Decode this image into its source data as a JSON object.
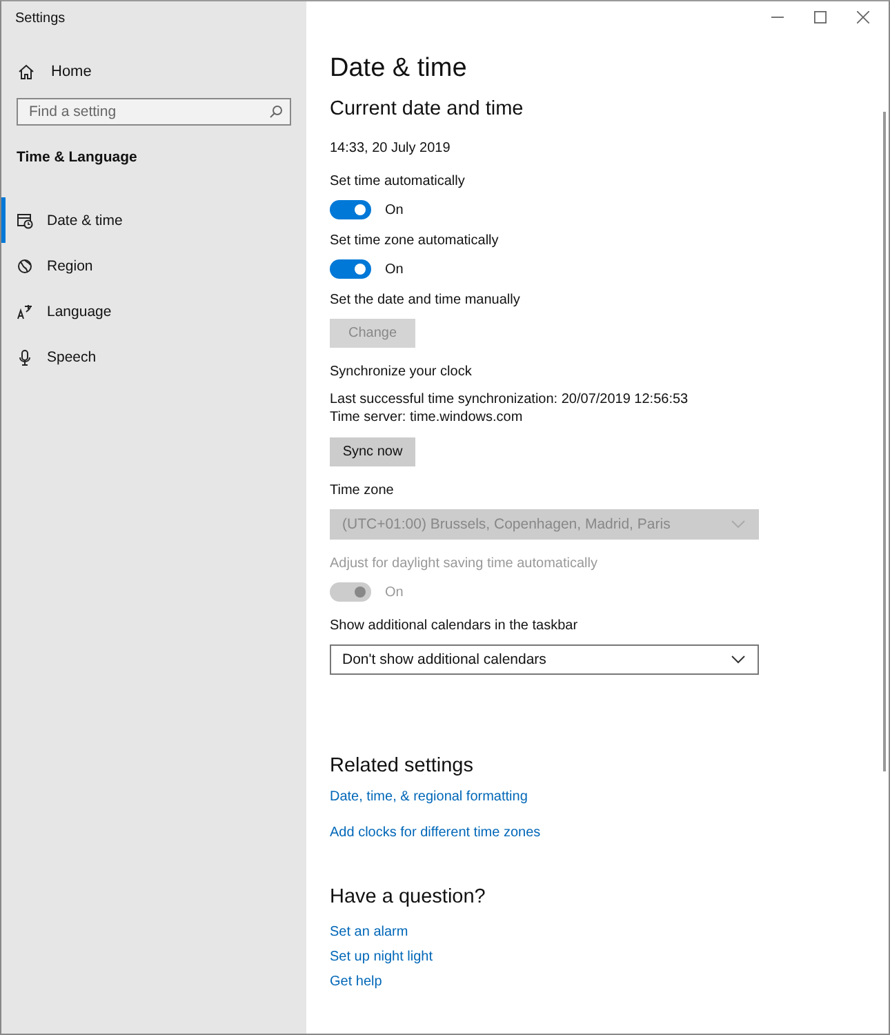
{
  "window": {
    "title": "Settings"
  },
  "sidebar": {
    "home": "Home",
    "search": {
      "placeholder": "Find a setting"
    },
    "section": "Time & Language",
    "items": [
      {
        "label": "Date & time",
        "kind": "calendar",
        "selected": true
      },
      {
        "label": "Region",
        "kind": "globe",
        "selected": false
      },
      {
        "label": "Language",
        "kind": "language",
        "selected": false
      },
      {
        "label": "Speech",
        "kind": "microphone",
        "selected": false
      }
    ]
  },
  "page": {
    "title": "Date & time",
    "groups": [
      {
        "items": [
          {
            "kind": "heading",
            "text": "Current date and time"
          },
          {
            "kind": "text",
            "text": "14:33, 20 July 2019",
            "disabled": false
          }
        ]
      },
      {
        "items": [
          {
            "kind": "label",
            "text": "Set time automatically",
            "disabled": false
          },
          {
            "kind": "toggle",
            "on": true,
            "text": "On",
            "disabled": false
          },
          {
            "kind": "label",
            "text": "Set time zone automatically",
            "disabled": false
          },
          {
            "kind": "toggle",
            "on": true,
            "text": "On",
            "disabled": false
          },
          {
            "kind": "label",
            "text": "Set the date and time manually",
            "disabled": false
          },
          {
            "kind": "button",
            "text": "Change",
            "disabled": true
          }
        ]
      },
      {
        "items": [
          {
            "kind": "label",
            "text": "Synchronize your clock",
            "disabled": false
          },
          {
            "kind": "text",
            "text": "Last successful time synchronization:  20/07/2019 12:56:53",
            "disabled": false
          },
          {
            "kind": "text",
            "text": "Time server: time.windows.com",
            "disabled": false
          },
          {
            "kind": "button",
            "text": "Sync now",
            "disabled": false
          }
        ]
      },
      {
        "items": [
          {
            "kind": "label",
            "text": "Time zone",
            "disabled": false
          },
          {
            "kind": "dropdown",
            "text": "(UTC+01:00) Brussels, Copenhagen, Madrid, Paris",
            "disabled": true
          }
        ]
      },
      {
        "items": [
          {
            "kind": "label",
            "text": "Adjust for daylight saving time automatically",
            "disabled": true
          },
          {
            "kind": "toggle",
            "on": true,
            "text": "On",
            "disabled": true
          }
        ]
      },
      {
        "items": [
          {
            "kind": "label",
            "text": "Show additional calendars in the taskbar",
            "disabled": false
          },
          {
            "kind": "dropdown",
            "text": "Don't show additional calendars",
            "disabled": false
          }
        ]
      }
    ],
    "related": {
      "title": "Related settings",
      "links": [
        "Date, time, & regional formatting",
        "Add clocks for different time zones"
      ]
    },
    "question": {
      "title": "Have a question?",
      "links": [
        "Set an alarm",
        "Set up night light",
        "Get help"
      ]
    }
  }
}
